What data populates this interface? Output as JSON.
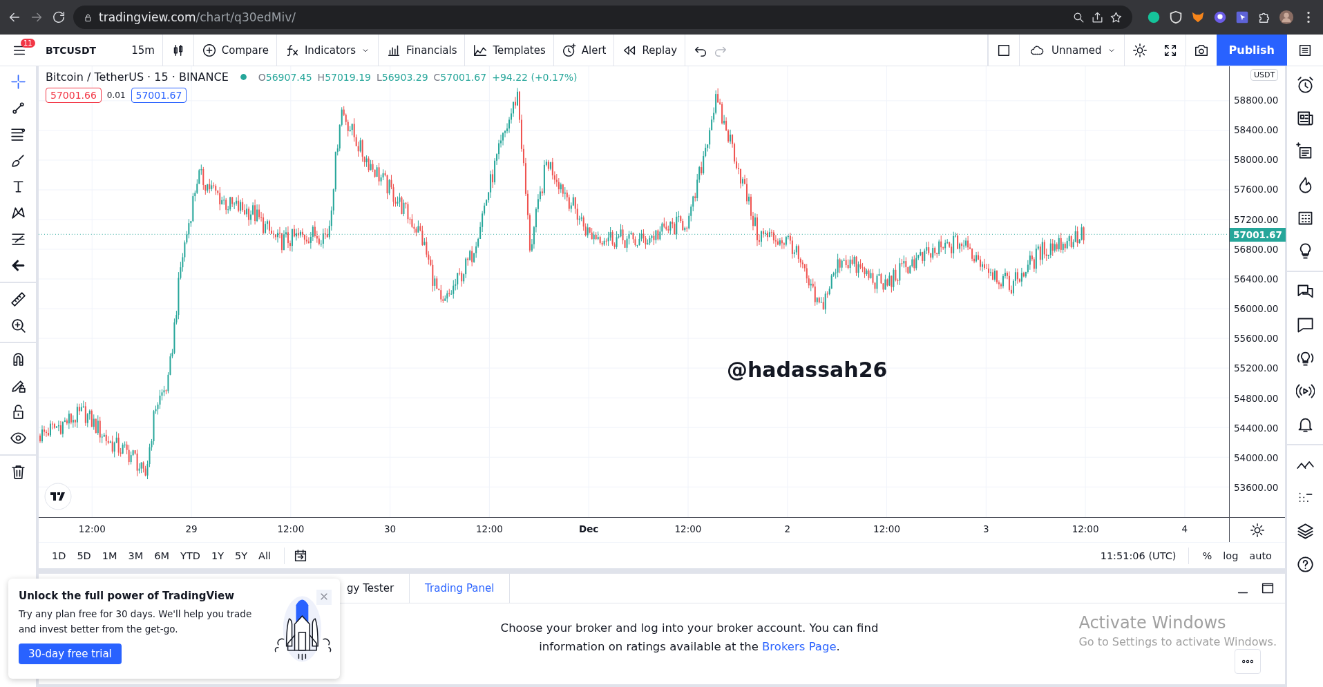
{
  "browser": {
    "url_host": "tradingview.com",
    "url_path": "/chart/q30edMiv/"
  },
  "toolbar": {
    "menu_badge": "11",
    "symbol": "BTCUSDT",
    "interval": "15m",
    "buttons": [
      {
        "kind": "compare",
        "label": "Compare",
        "caret": false
      },
      {
        "kind": "indicators",
        "label": "Indicators",
        "caret": true
      },
      {
        "kind": "financials",
        "label": "Financials",
        "caret": false
      },
      {
        "kind": "templates",
        "label": "Templates",
        "caret": false
      },
      {
        "kind": "alert",
        "label": "Alert",
        "caret": false
      },
      {
        "kind": "replay",
        "label": "Replay",
        "caret": false
      }
    ],
    "layout_name": "Unnamed",
    "publish": "Publish"
  },
  "legend": {
    "title": "Bitcoin / TetherUS · 15 · BINANCE",
    "ohlc": [
      {
        "label": "O",
        "value": "56907.45"
      },
      {
        "label": "H",
        "value": "57019.19"
      },
      {
        "label": "L",
        "value": "56903.29"
      },
      {
        "label": "C",
        "value": "57001.67"
      }
    ],
    "change": "+94.22 (+0.17%)",
    "sell": "57001.66",
    "spread": "0.01",
    "buy": "57001.67"
  },
  "chart": {
    "currency": "USDT",
    "last_price": "57001.67",
    "watermark": "@hadassah26",
    "price_ticks": [
      "58800.00",
      "58400.00",
      "58000.00",
      "57600.00",
      "57200.00",
      "56800.00",
      "56400.00",
      "56000.00",
      "55600.00",
      "55200.00",
      "54800.00",
      "54400.00",
      "54000.00",
      "53600.00"
    ],
    "time_ticks": [
      {
        "label": "12:00",
        "kind": "time"
      },
      {
        "label": "29",
        "kind": "day"
      },
      {
        "label": "12:00",
        "kind": "time"
      },
      {
        "label": "30",
        "kind": "day"
      },
      {
        "label": "12:00",
        "kind": "time"
      },
      {
        "label": "Dec",
        "kind": "month"
      },
      {
        "label": "12:00",
        "kind": "time"
      },
      {
        "label": "2",
        "kind": "day"
      },
      {
        "label": "12:00",
        "kind": "time"
      },
      {
        "label": "3",
        "kind": "day"
      },
      {
        "label": "12:00",
        "kind": "time"
      },
      {
        "label": "4",
        "kind": "day"
      }
    ]
  },
  "range_bar": {
    "ranges": [
      "1D",
      "5D",
      "1M",
      "3M",
      "6M",
      "YTD",
      "1Y",
      "5Y",
      "All"
    ],
    "clock": "11:51:06 (UTC)",
    "scale_options": [
      "%",
      "log",
      "auto"
    ]
  },
  "bottom_panel": {
    "tabs": [
      {
        "label": "gy Tester",
        "selected": false
      },
      {
        "label": "Trading Panel",
        "selected": true
      }
    ],
    "message": "Choose your broker and log into your broker account. You can find information on ratings available at the ",
    "link": "Brokers Page",
    "message_end": "."
  },
  "promo": {
    "title": "Unlock the full power of TradingView",
    "text": "Try any plan free for 30 days. We'll help you trade and invest better from the get-go.",
    "button": "30-day free trial"
  },
  "os_notice": {
    "title": "Activate Windows",
    "text": "Go to Settings to activate Windows."
  }
}
